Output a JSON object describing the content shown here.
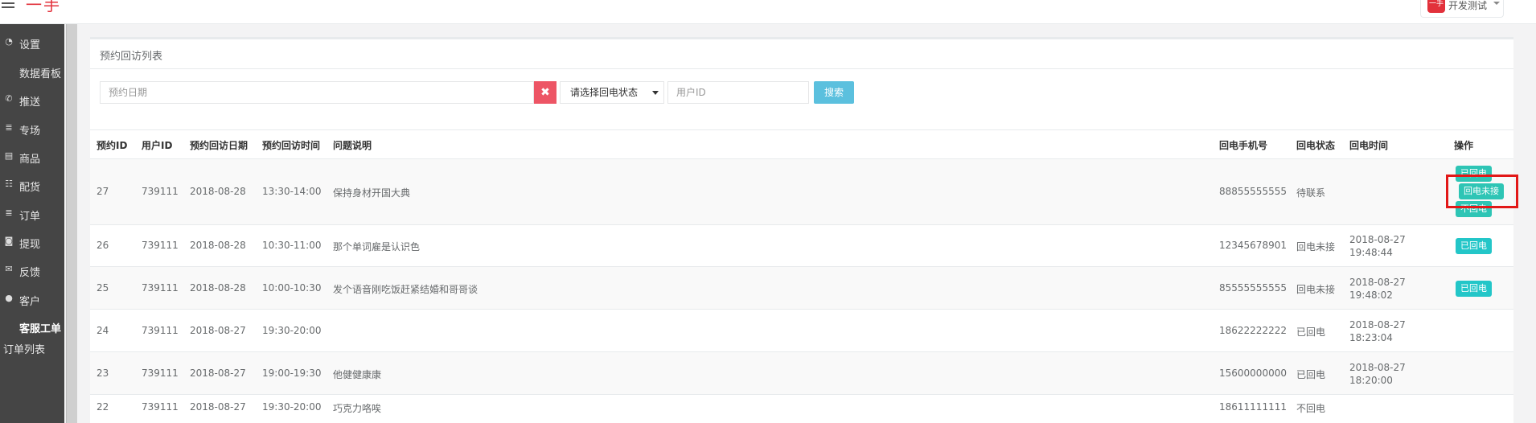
{
  "header": {
    "logo_text": "一手",
    "user_avatar_text": "一手",
    "user_name": "开发测试"
  },
  "sidebar": {
    "items": [
      {
        "icon": "dashboard-icon",
        "glyph": "◔",
        "label": "设置"
      },
      {
        "sub": true,
        "label": "数据看板"
      },
      {
        "icon": "phone-icon",
        "glyph": "✆",
        "label": "推送"
      },
      {
        "icon": "list-icon",
        "glyph": "≣",
        "label": "专场"
      },
      {
        "icon": "table-icon",
        "glyph": "▤",
        "label": "商品"
      },
      {
        "icon": "list-ol-icon",
        "glyph": "☷",
        "label": "配货"
      },
      {
        "icon": "list-icon",
        "glyph": "≣",
        "label": "订单"
      },
      {
        "icon": "money-icon",
        "glyph": "◙",
        "label": "提现"
      },
      {
        "icon": "comments-icon",
        "glyph": "✉",
        "label": "反馈"
      },
      {
        "icon": "user-icon",
        "glyph": "●",
        "label": "客户"
      },
      {
        "sub": true,
        "active": true,
        "label": "客服工单"
      },
      {
        "sub": true,
        "label": "订单列表"
      }
    ]
  },
  "panel": {
    "title": "预约回访列表",
    "date_placeholder": "预约日期",
    "clear_glyph": "✖",
    "status_select_value": "请选择回电状态",
    "userid_placeholder": "用户ID",
    "search_label": "搜索"
  },
  "table": {
    "columns": [
      "预约ID",
      "用户ID",
      "预约回访日期",
      "预约回访时间",
      "问题说明",
      "回电手机号",
      "回电状态",
      "回电时间",
      "操作"
    ],
    "rows": [
      {
        "id": "27",
        "user_id": "739111",
        "date": "2018-08-28",
        "time": "13:30-14:00",
        "desc": "保持身材开国大典",
        "phone": "88855555555",
        "status": "待联系",
        "call_date": "",
        "call_time": "",
        "actions": [
          "已回电",
          "回电未接",
          "不回电"
        ]
      },
      {
        "id": "26",
        "user_id": "739111",
        "date": "2018-08-28",
        "time": "10:30-11:00",
        "desc": "那个单词雇是认识色",
        "phone": "12345678901",
        "status": "回电未接",
        "call_date": "2018-08-27",
        "call_time": "19:48:44",
        "actions": [
          "已回电"
        ]
      },
      {
        "id": "25",
        "user_id": "739111",
        "date": "2018-08-28",
        "time": "10:00-10:30",
        "desc": "发个语音刚吃饭赶紧结婚和哥哥谈",
        "phone": "85555555555",
        "status": "回电未接",
        "call_date": "2018-08-27",
        "call_time": "19:48:02",
        "actions": [
          "已回电"
        ]
      },
      {
        "id": "24",
        "user_id": "739111",
        "date": "2018-08-27",
        "time": "19:30-20:00",
        "desc": "",
        "phone": "18622222222",
        "status": "已回电",
        "call_date": "2018-08-27",
        "call_time": "18:23:04",
        "actions": []
      },
      {
        "id": "23",
        "user_id": "739111",
        "date": "2018-08-27",
        "time": "19:00-19:30",
        "desc": "他健健康康",
        "phone": "15600000000",
        "status": "已回电",
        "call_date": "2018-08-27",
        "call_time": "18:20:00",
        "actions": []
      },
      {
        "id": "22",
        "user_id": "739111",
        "date": "2018-08-27",
        "time": "19:30-20:00",
        "desc": "巧克力咯唉",
        "phone": "18611111111",
        "status": "不回电",
        "call_date": "",
        "call_time": "",
        "actions": []
      }
    ]
  },
  "colors": {
    "sidebar_bg": "#454545",
    "badge": "#2ec5b5",
    "clear_button": "#ed5565",
    "search_button": "#5bc0de",
    "highlight_frame": "#e21818",
    "logo": "#e2313b"
  }
}
